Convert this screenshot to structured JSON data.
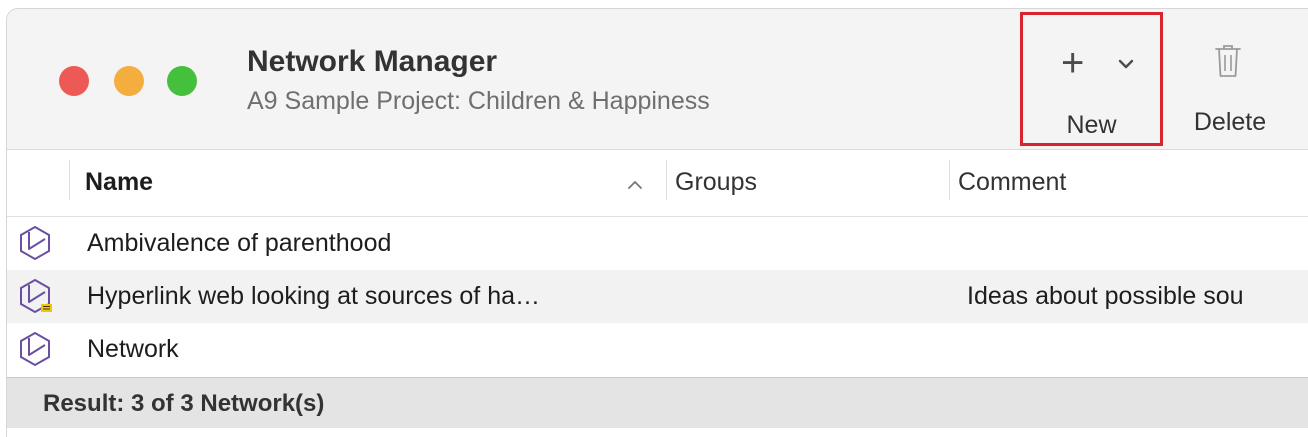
{
  "window": {
    "title": "Network Manager",
    "subtitle": "A9 Sample Project: Children & Happiness"
  },
  "toolbar": {
    "new_label": "New",
    "new_icon": "plus-icon",
    "new_menu_icon": "chevron-down-icon",
    "delete_label": "Delete",
    "delete_icon": "trash-icon",
    "highlight_color": "#d9232e"
  },
  "table": {
    "columns": [
      "Name",
      "Groups",
      "Comment"
    ],
    "sort_column": "Name",
    "sort_direction": "ascending",
    "rows": [
      {
        "name": "Ambivalence of parenthood",
        "groups": "",
        "comment": "",
        "icon": "network-icon",
        "has_comment_badge": false
      },
      {
        "name": "Hyperlink web looking at sources of ha…",
        "groups": "",
        "comment": "Ideas about possible sou",
        "icon": "network-icon",
        "has_comment_badge": true
      },
      {
        "name": "Network",
        "groups": "",
        "comment": "",
        "icon": "network-icon",
        "has_comment_badge": false
      }
    ]
  },
  "footer": {
    "result": "Result: 3 of 3 Network(s)"
  },
  "colors": {
    "close": "#ed5a56",
    "minimize": "#f4ae3f",
    "zoom": "#45c03c",
    "network_icon": "#6b4fa3",
    "comment_badge": "#f2c600"
  }
}
